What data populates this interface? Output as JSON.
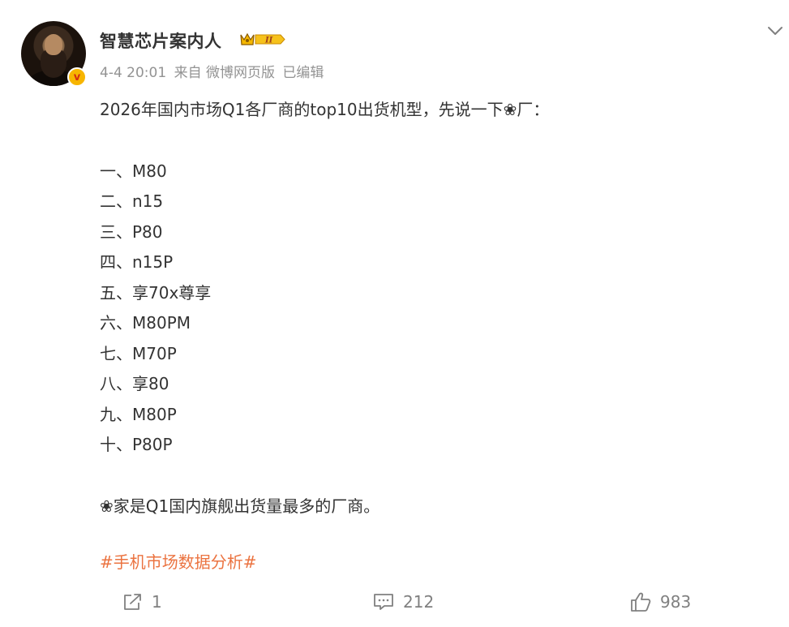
{
  "post": {
    "author": {
      "name": "智慧芯片案内人",
      "verified_mark": "v",
      "badge_level": "II"
    },
    "meta": {
      "timestamp": "4-4 20:01",
      "source": "来自 微博网页版",
      "edited": "已编辑"
    },
    "content": {
      "intro": "2026年国内市场Q1各厂商的top10出货机型，先说一下❀厂：",
      "list": [
        "一、M80",
        "二、n15",
        "三、P80",
        "四、n15P",
        "五、享70x尊享",
        "六、M80PM",
        "七、M70P",
        "八、享80",
        "九、M80P",
        "十、P80P"
      ],
      "conclusion": "❀家是Q1国内旗舰出货量最多的厂商。"
    },
    "topic": "#手机市场数据分析#",
    "actions": {
      "share_count": "1",
      "comment_count": "212",
      "like_count": "983"
    }
  },
  "colors": {
    "text": "#333333",
    "meta": "#939393",
    "topic": "#eb7340",
    "action": "#808080",
    "verified_bg": "#f7b500"
  }
}
